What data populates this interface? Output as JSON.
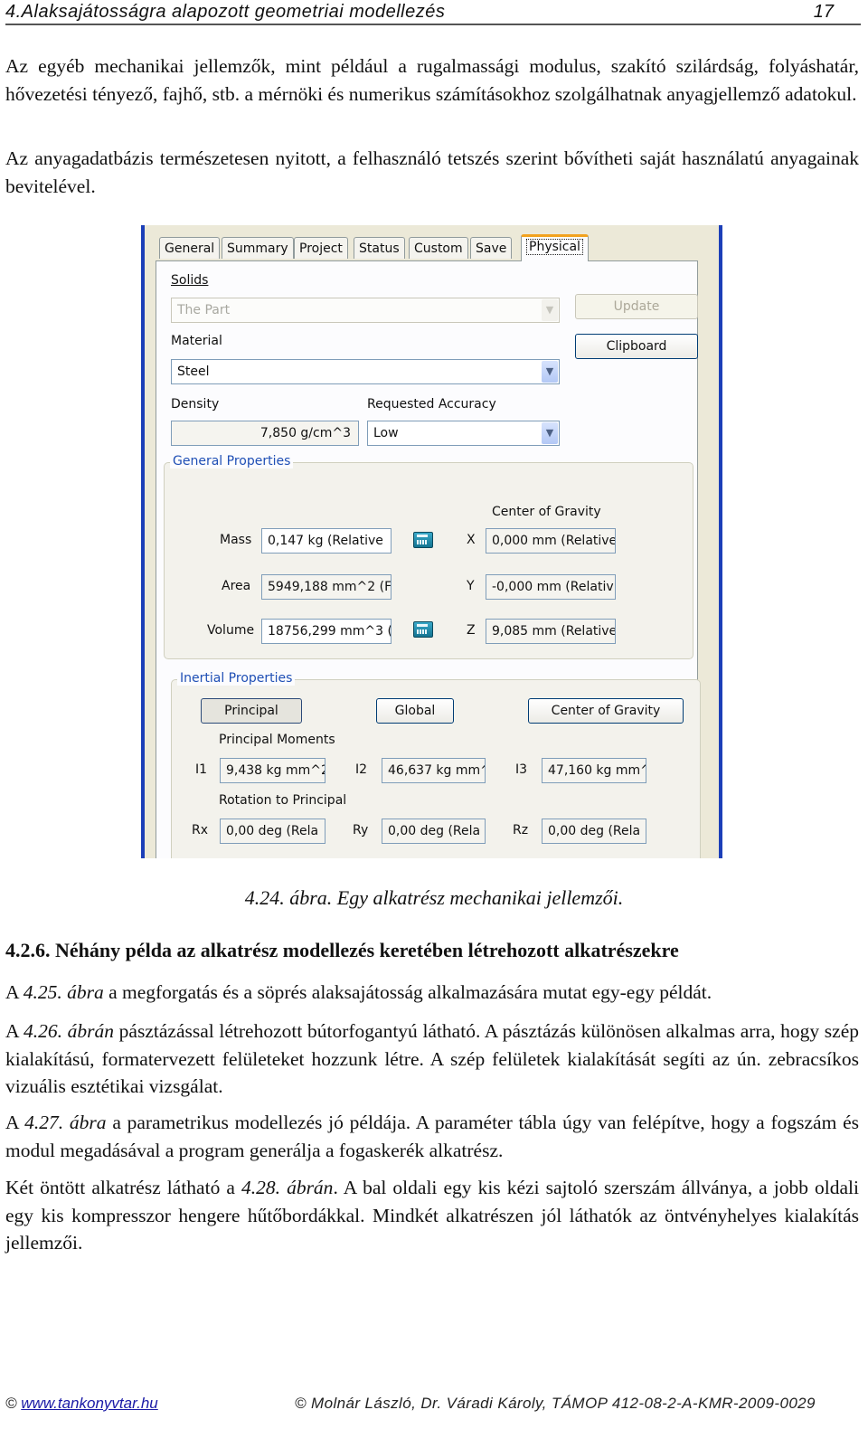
{
  "header": {
    "title": "4.Alaksajátosságra alapozott geometriai modellezés",
    "page_number": "17"
  },
  "paragraphs": {
    "p1": "Az egyéb mechanikai jellemzők, mint például a rugalmassági modulus, szakító szilárdság, folyáshatár, hővezetési tényező, fajhő, stb. a mérnöki és numerikus számításokhoz szolgálhatnak anyagjellemző adatokul.",
    "p2": "Az anyagadatbázis természetesen nyitott, a felhasználó tetszés szerint bővítheti saját használatú anyagainak bevitelével."
  },
  "dialog": {
    "tabs": [
      {
        "label": "General"
      },
      {
        "label": "Summary"
      },
      {
        "label": "Project"
      },
      {
        "label": "Status"
      },
      {
        "label": "Custom"
      },
      {
        "label": "Save"
      },
      {
        "label": "Physical",
        "active": true
      }
    ],
    "solids_label": "Solids",
    "solids_value": "The Part",
    "update_button": "Update",
    "material_label": "Material",
    "material_value": "Steel",
    "clipboard_button": "Clipboard",
    "density_label": "Density",
    "density_value": "7,850 g/cm^3",
    "accuracy_label": "Requested Accuracy",
    "accuracy_value": "Low",
    "general_properties": {
      "title": "General Properties",
      "center_of_gravity_label": "Center of Gravity",
      "mass_label": "Mass",
      "mass_value": "0,147 kg (Relative",
      "area_label": "Area",
      "area_value": "5949,188 mm^2 (F",
      "volume_label": "Volume",
      "volume_value": "18756,299 mm^3 (",
      "x_label": "X",
      "x_value": "0,000 mm (Relative",
      "y_label": "Y",
      "y_value": "-0,000 mm (Relativ",
      "z_label": "Z",
      "z_value": "9,085 mm (Relative"
    },
    "inertial_properties": {
      "title": "Inertial Properties",
      "principal_button": "Principal",
      "global_button": "Global",
      "cog_button": "Center of Gravity",
      "principal_moments_label": "Principal Moments",
      "i1_label": "I1",
      "i1_value": "9,438 kg mm^2",
      "i2_label": "I2",
      "i2_value": "46,637 kg mm^",
      "i3_label": "I3",
      "i3_value": "47,160 kg mm^",
      "rotation_label": "Rotation to Principal",
      "rx_label": "Rx",
      "rx_value": "0,00 deg (Rela",
      "ry_label": "Ry",
      "ry_value": "0,00 deg (Rela",
      "rz_label": "Rz",
      "rz_value": "0,00 deg (Rela"
    }
  },
  "caption": "4.24. ábra. Egy alkatrész mechanikai jellemzői.",
  "section": {
    "title": "4.2.6. Néhány példa az alkatrész modellezés keretében létrehozott alkatrészekre"
  },
  "body": {
    "p3_pre": "A ",
    "p3_ref": "4.25. ábra",
    "p3_post": " a megforgatás és a söprés alaksajátosság alkalmazására mutat egy-egy példát.",
    "p4_pre": "A ",
    "p4_ref": "4.26. ábrán",
    "p4_post": " pásztázással létrehozott bútorfogantyú látható. A pásztázás különösen alkalmas arra, hogy szép kialakítású, formatervezett felületeket hozzunk létre. A szép felületek kialakítását segíti az ún. zebracsíkos vizuális esztétikai vizsgálat.",
    "p5_pre": "A ",
    "p5_ref": "4.27. ábra",
    "p5_post": " a parametrikus modellezés jó példája. A paraméter tábla úgy van felépítve, hogy a fogszám és modul megadásával a program generálja a fogaskerék alkatrész.",
    "p6_pre": "Két öntött alkatrész látható a ",
    "p6_ref": "4.28. ábrán",
    "p6_post": ". A bal oldali egy kis kézi sajtoló szerszám állványa, a jobb oldali egy kis kompresszor hengere hűtőbordákkal. Mindkét alkatrészen jól láthatók az öntvényhelyes kialakítás jellemzői."
  },
  "footer": {
    "left_symbol": "©",
    "left_link": "www.tankonyvtar.hu",
    "right": "© Molnár László, Dr. Váradi Károly, TÁMOP 412-08-2-A-KMR-2009-0029"
  }
}
